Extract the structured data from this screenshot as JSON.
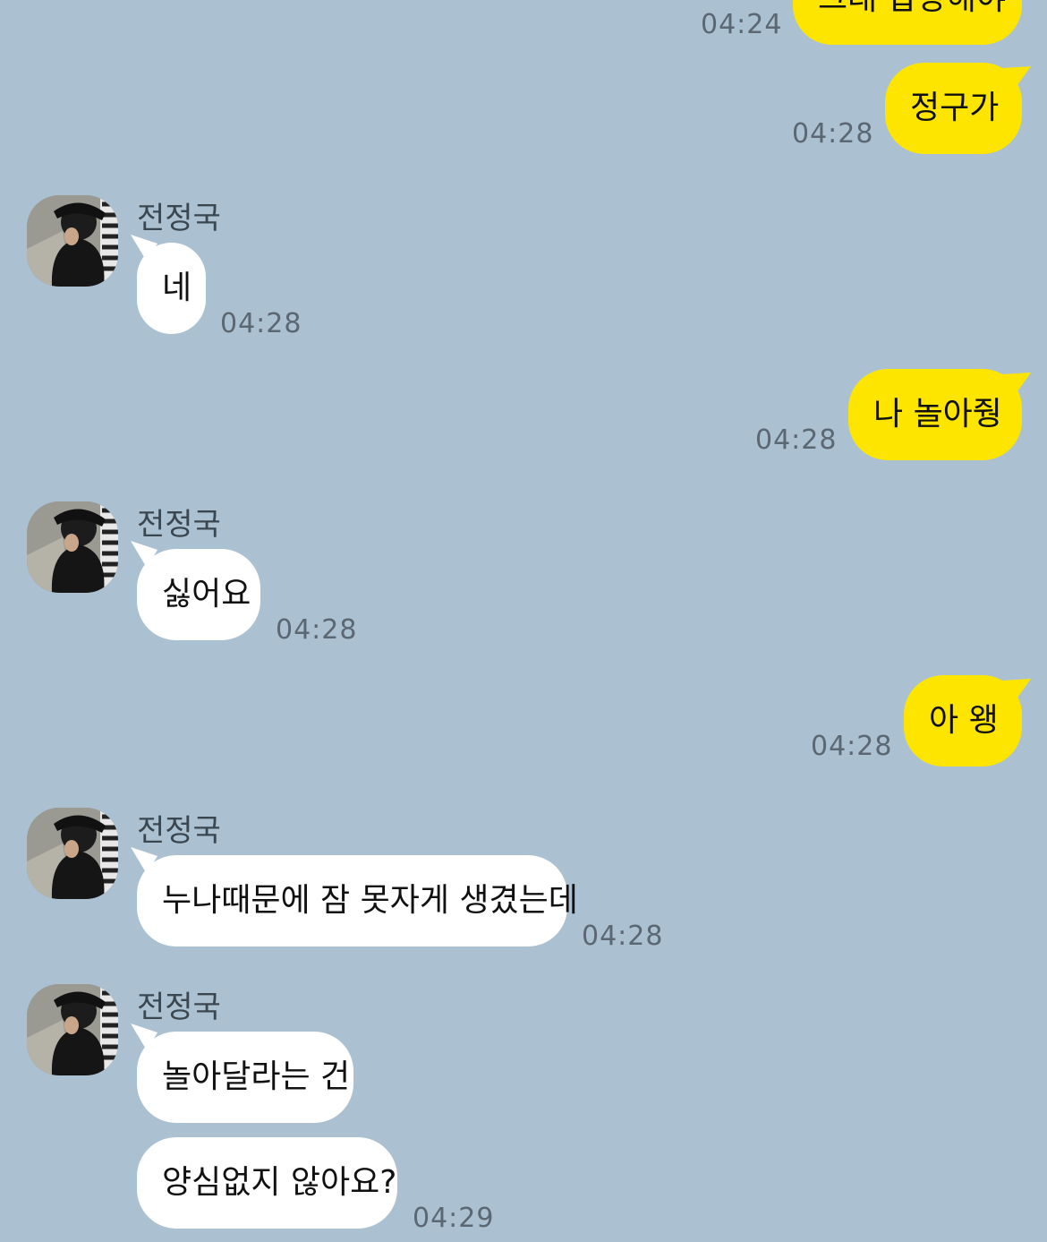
{
  "contact": {
    "name": "전정국"
  },
  "messages": [
    {
      "side": "me",
      "text": "그래 답장해야",
      "time": "04:24"
    },
    {
      "side": "me",
      "text": "정구가",
      "time": "04:28"
    },
    {
      "side": "them",
      "text": "네",
      "time": "04:28"
    },
    {
      "side": "me",
      "text": "나 놀아줭",
      "time": "04:28"
    },
    {
      "side": "them",
      "text": "싫어요",
      "time": "04:28"
    },
    {
      "side": "me",
      "text": "아 왱",
      "time": "04:28"
    },
    {
      "side": "them",
      "text": "누나때문에 잠 못자게 생겼는데",
      "time": "04:28"
    },
    {
      "side": "them",
      "text": "놀아달라는 건",
      "time": ""
    },
    {
      "side": "them",
      "text": "양심없지 않아요?",
      "time": "04:29"
    }
  ],
  "colors": {
    "background": "#abc1d1",
    "my_bubble": "#fee500",
    "their_bubble": "#ffffff",
    "timestamp": "#5b6772"
  },
  "icons": {
    "avatar": "profile-photo"
  }
}
